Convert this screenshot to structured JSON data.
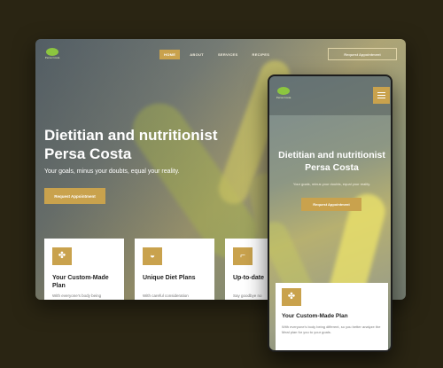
{
  "desktop": {
    "logo_text": "Persa Costa",
    "nav": [
      {
        "label": "HOME",
        "active": true
      },
      {
        "label": "ABOUT",
        "active": false
      },
      {
        "label": "SERVICES",
        "active": false
      },
      {
        "label": "RECIPES",
        "active": false
      }
    ],
    "header_cta": "Request Appointment",
    "hero": {
      "title": "Dietitian and nutritionist Persa Costa",
      "subtitle": "Your goals, minus your doubts, equal your reality.",
      "button": "Request Appointment"
    },
    "cards": [
      {
        "icon": "plan-icon",
        "title": "Your Custom-Made Plan",
        "body": "With everyone's body being"
      },
      {
        "icon": "diet-bowl-icon",
        "title": "Unique Diet Plans",
        "body": "With careful consideration"
      },
      {
        "icon": "up-to-date-icon",
        "title": "Up-to-date",
        "body": "Say goodbye no"
      }
    ]
  },
  "mobile": {
    "logo_text": "Persa Costa",
    "hero": {
      "title": "Dietitian and nutritionist Persa Costa",
      "subtitle": "Your goals, minus your doubts, equal your reality.",
      "button": "Request Appointment"
    },
    "card": {
      "icon": "plan-icon",
      "title": "Your Custom-Made Plan",
      "body": "With everyone's body being different, so you better analyze the Meal plan for you to your goals."
    }
  },
  "colors": {
    "accent": "#c9a24d",
    "background": "#2a2513",
    "logo_green": "#8cc63f"
  }
}
